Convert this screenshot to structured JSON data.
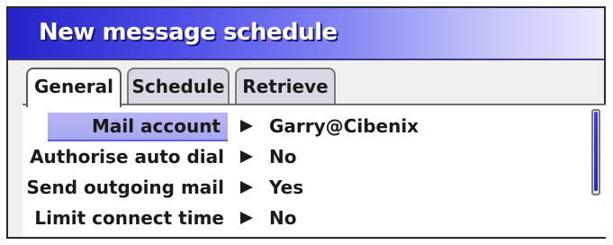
{
  "window": {
    "title": "New message schedule"
  },
  "tabs": [
    {
      "label": "General",
      "active": true
    },
    {
      "label": "Schedule",
      "active": false
    },
    {
      "label": "Retrieve",
      "active": false
    }
  ],
  "settings": [
    {
      "label": "Mail account",
      "value": "Garry@Cibenix",
      "selected": true
    },
    {
      "label": "Authorise auto dial",
      "value": "No",
      "selected": false
    },
    {
      "label": "Send outgoing mail",
      "value": "Yes",
      "selected": false
    },
    {
      "label": "Limit connect time",
      "value": "No",
      "selected": false
    }
  ],
  "colors": {
    "title_gradient_start": "#2323c9",
    "selection": "#b7b7f6",
    "scrollbar_thumb": "#3f3fd6"
  },
  "icons": {
    "row_arrow": "right-triangle-icon"
  }
}
